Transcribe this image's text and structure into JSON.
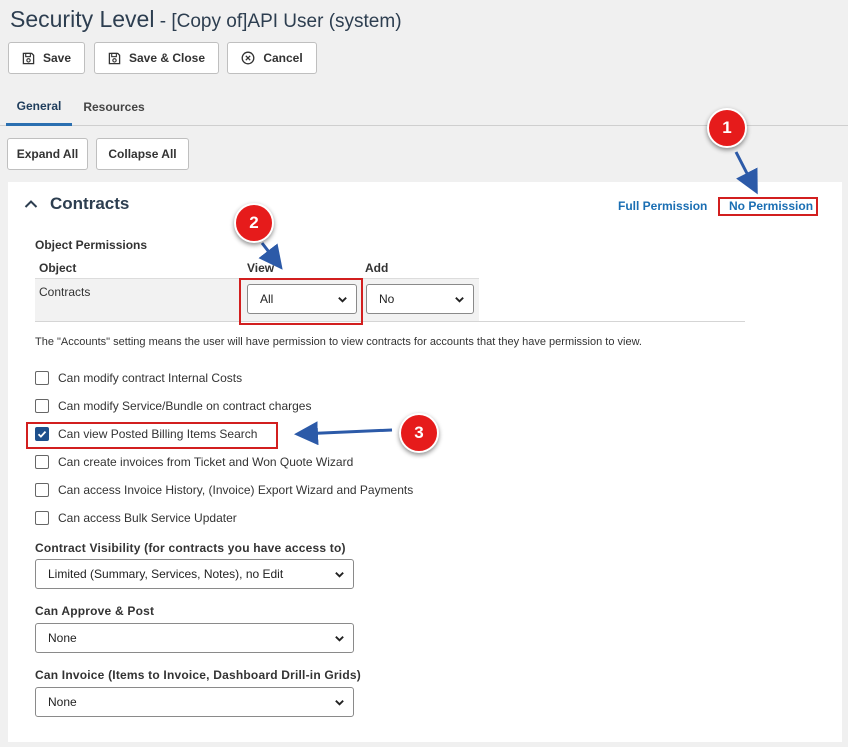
{
  "header": {
    "title": "Security Level",
    "subtitle": " - [Copy of]API User (system)"
  },
  "toolbar": {
    "save_label": "Save",
    "save_close_label": "Save & Close",
    "cancel_label": "Cancel"
  },
  "tabs": [
    {
      "label": "General",
      "active": true
    },
    {
      "label": "Resources",
      "active": false
    }
  ],
  "actions": {
    "expand_all": "Expand All",
    "collapse_all": "Collapse All"
  },
  "section": {
    "title": "Contracts",
    "full_permission": "Full Permission",
    "no_permission": "No Permission"
  },
  "object_permissions": {
    "heading": "Object Permissions",
    "col_object": "Object",
    "col_view": "View",
    "col_add": "Add",
    "row_object": "Contracts",
    "view_value": "All",
    "add_value": "No"
  },
  "note": "The \"Accounts\" setting means the user will have permission to view contracts for accounts that they have permission to view.",
  "checkboxes": [
    {
      "label": "Can modify contract Internal Costs",
      "checked": false
    },
    {
      "label": "Can modify Service/Bundle on contract charges",
      "checked": false
    },
    {
      "label": "Can view Posted Billing Items Search",
      "checked": true
    },
    {
      "label": "Can create invoices from Ticket and Won Quote Wizard",
      "checked": false
    },
    {
      "label": "Can access Invoice History, (Invoice) Export Wizard and Payments",
      "checked": false
    },
    {
      "label": "Can access Bulk Service Updater",
      "checked": false
    }
  ],
  "fields": {
    "visibility_label": "Contract Visibility (for contracts you have access to)",
    "visibility_value": "Limited (Summary, Services, Notes), no Edit",
    "approve_label": "Can Approve & Post",
    "approve_value": "None",
    "invoice_label": "Can Invoice (Items to Invoice, Dashboard Drill-in Grids)",
    "invoice_value": "None"
  },
  "callouts": [
    "1",
    "2",
    "3"
  ],
  "colors": {
    "accent": "#2a6fb0",
    "link": "#1a6eb3",
    "highlight": "#d21f1f",
    "badge": "#e61b1b",
    "arrow": "#2c5aa8",
    "checkbox": "#1d4f8c"
  },
  "icons": {
    "save": "floppy-disk-icon",
    "cancel": "circle-x-icon",
    "collapse": "chevron-up-icon",
    "dropdown": "chevron-down-icon"
  }
}
